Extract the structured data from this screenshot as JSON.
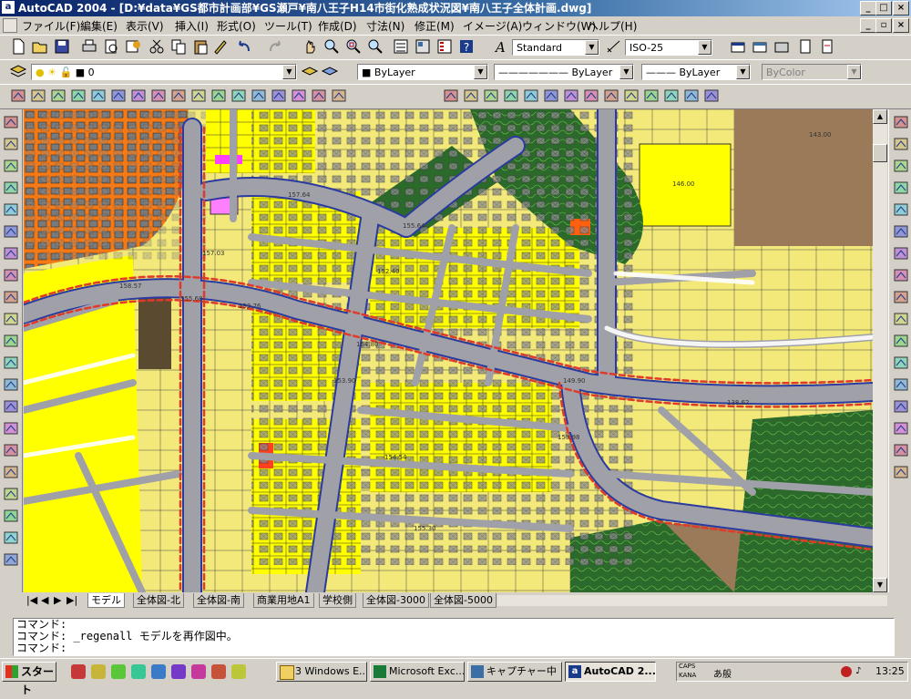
{
  "window": {
    "app_icon": "a",
    "title": "AutoCAD 2004 - [D:¥data¥GS都市計画部¥GS瀬戸¥南八王子H14市街化熟成状況図¥南八王子全体計画.dwg]"
  },
  "menu": [
    "ファイル(F)",
    "編集(E)",
    "表示(V)",
    "挿入(I)",
    "形式(O)",
    "ツール(T)",
    "作成(D)",
    "寸法(N)",
    "修正(M)",
    "イメージ(A)",
    "ウィンドウ(W)",
    "ヘルプ(H)"
  ],
  "toolbar": {
    "text_style": "Standard",
    "dim_style": "ISO-25",
    "layer": "0",
    "color": "ByLayer",
    "linetype": "ByLayer",
    "lineweight": "ByLayer",
    "plotstyle": "ByColor"
  },
  "map_labels": [
    {
      "text": "143.00",
      "color": "#3a2a1a"
    },
    {
      "text": "146.00",
      "color": "#333"
    },
    {
      "text": "157.64",
      "color": "#333"
    },
    {
      "text": "155.64",
      "color": "#333"
    },
    {
      "text": "158.57",
      "color": "#333"
    },
    {
      "text": "155.68",
      "color": "#333"
    },
    {
      "text": "152.40",
      "color": "#333"
    },
    {
      "text": "154.80",
      "color": "#333"
    },
    {
      "text": "153.76",
      "color": "#333"
    },
    {
      "text": "153.90",
      "color": "#333"
    },
    {
      "text": "149.90",
      "color": "#333"
    },
    {
      "text": "138.62",
      "color": "#333"
    },
    {
      "text": "153.98",
      "color": "#333"
    },
    {
      "text": "154.54",
      "color": "#333"
    },
    {
      "text": "155.30",
      "color": "#333"
    },
    {
      "text": "157.03",
      "color": "#333"
    }
  ],
  "tabs": [
    "モデル",
    "全体図-北",
    "全体図-南",
    "商業用地A1",
    "学校側",
    "全体図-3000",
    "全体図-5000"
  ],
  "active_tab": 0,
  "command_lines": [
    "コマンド:",
    "コマンド: _regenall モデルを再作図中。",
    "コマンド:"
  ],
  "taskbar": {
    "start": "スタート",
    "tasks": [
      "3 Windows E...",
      "Microsoft Exc...",
      "キャプチャー中",
      "AutoCAD 2..."
    ],
    "tray_caps": "CAPS",
    "tray_kana": "KANA",
    "clock": "13:25"
  },
  "colors": {
    "parcel": "#f3e97a",
    "parcel_bright": "#ffff00",
    "road": "#a0a0a8",
    "road_edge": "#2a3aa0",
    "red_dash": "#e03a2a",
    "orange_zone": "#f47a18",
    "green_zone": "#2c6a2c",
    "brown_zone": "#9a7a58",
    "building": "#909090"
  }
}
